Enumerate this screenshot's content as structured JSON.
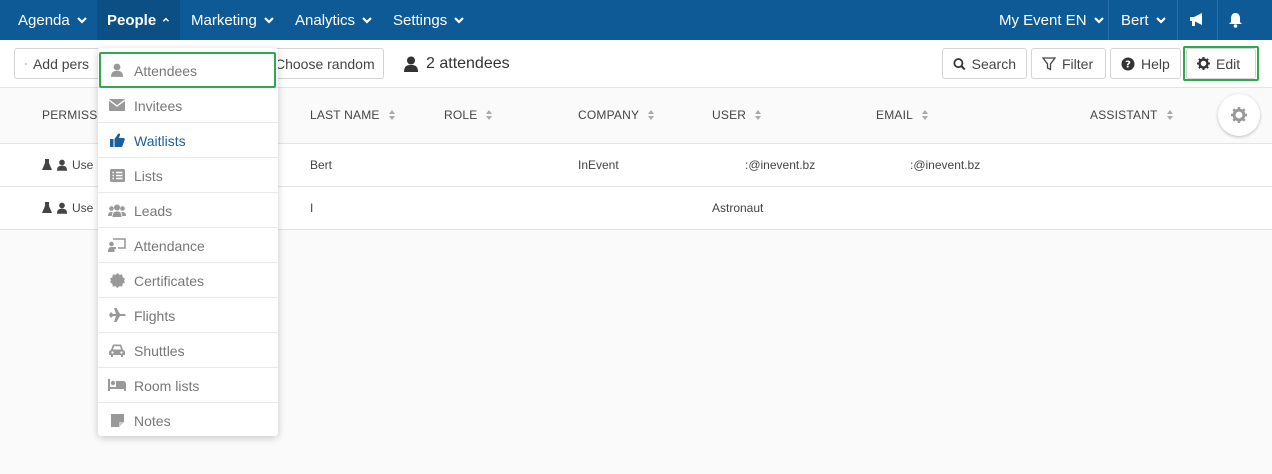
{
  "nav": {
    "items": [
      {
        "label": "Agenda"
      },
      {
        "label": "People"
      },
      {
        "label": "Marketing"
      },
      {
        "label": "Analytics"
      },
      {
        "label": "Settings"
      }
    ],
    "event": "My Event EN",
    "user": "Bert"
  },
  "toolbar": {
    "add_label": "Add pers",
    "random_label": "Choose random",
    "count_label": "2 attendees",
    "search_label": "Search",
    "filter_label": "Filter",
    "help_label": "Help",
    "edit_label": "Edit"
  },
  "table": {
    "headers": [
      "PERMISSIO",
      "LAST NAME",
      "ROLE",
      "COMPANY",
      "USER",
      "EMAIL",
      "ASSISTANT"
    ],
    "rows": [
      {
        "permission": "Use",
        "last_name": "Bert",
        "role": "",
        "company": "InEvent",
        "user": ":@inevent.bz",
        "email": ":@inevent.bz",
        "assistant": ""
      },
      {
        "permission": "Use",
        "last_name": "I",
        "role": "",
        "company": "",
        "user": "Astronaut",
        "email": "",
        "assistant": ""
      }
    ]
  },
  "people_menu": {
    "items": [
      {
        "label": "Attendees",
        "icon": "user-icon"
      },
      {
        "label": "Invitees",
        "icon": "envelope-icon"
      },
      {
        "label": "Waitlists",
        "icon": "thumbs-up-icon"
      },
      {
        "label": "Lists",
        "icon": "list-icon"
      },
      {
        "label": "Leads",
        "icon": "users-icon"
      },
      {
        "label": "Attendance",
        "icon": "presenter-icon"
      },
      {
        "label": "Certificates",
        "icon": "certificate-icon"
      },
      {
        "label": "Flights",
        "icon": "plane-icon"
      },
      {
        "label": "Shuttles",
        "icon": "car-icon"
      },
      {
        "label": "Room lists",
        "icon": "bed-icon"
      },
      {
        "label": "Notes",
        "icon": "note-icon"
      }
    ]
  },
  "colors": {
    "nav_bg": "#0e5a96",
    "highlight_green": "#2fa84f",
    "link_blue": "#1a5f9e"
  }
}
